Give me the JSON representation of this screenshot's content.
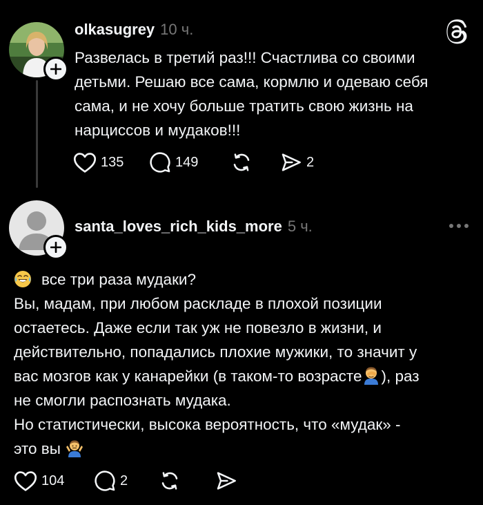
{
  "post": {
    "username": "olkasugrey",
    "time": "10 ч.",
    "text": "Развелась в третий раз!!! Счастлива со своими\nдетьми. Решаю все сама, кормлю и одеваю себя\nсама, и не хочу больше тратить свою жизнь на\nнарциссов и мудаков!!!",
    "likes": "135",
    "replies": "149",
    "shares": "2",
    "logo_icon": "threads-logo-icon"
  },
  "reply": {
    "username": "santa_loves_rich_kids_more",
    "time": "5 ч.",
    "line1": "все три раза мудаки?",
    "line1_emoji": "face-with-tears-of-joy",
    "paragraph2_a": "Вы, мадам, при любом раскладе в плохой позиции\nостаетесь. Даже если так уж не повезло в жизни, и\nдействительно, попадались плохие мужики, то значит у\nвас мозгов как у канарейки (в таком-то возрасте",
    "paragraph2_emoji": "person-facepalming",
    "paragraph2_b": "), раз\nне смогли распознать мудака.",
    "paragraph3": "Но статистически, высока вероятность, что «мудак» -\nэто вы",
    "paragraph3_emoji": "person-shrugging",
    "likes": "104",
    "replies": "2"
  },
  "colors": {
    "background": "#000000",
    "text": "#f3f5f7",
    "muted": "#777777",
    "thread_line": "#3a3a3a"
  }
}
